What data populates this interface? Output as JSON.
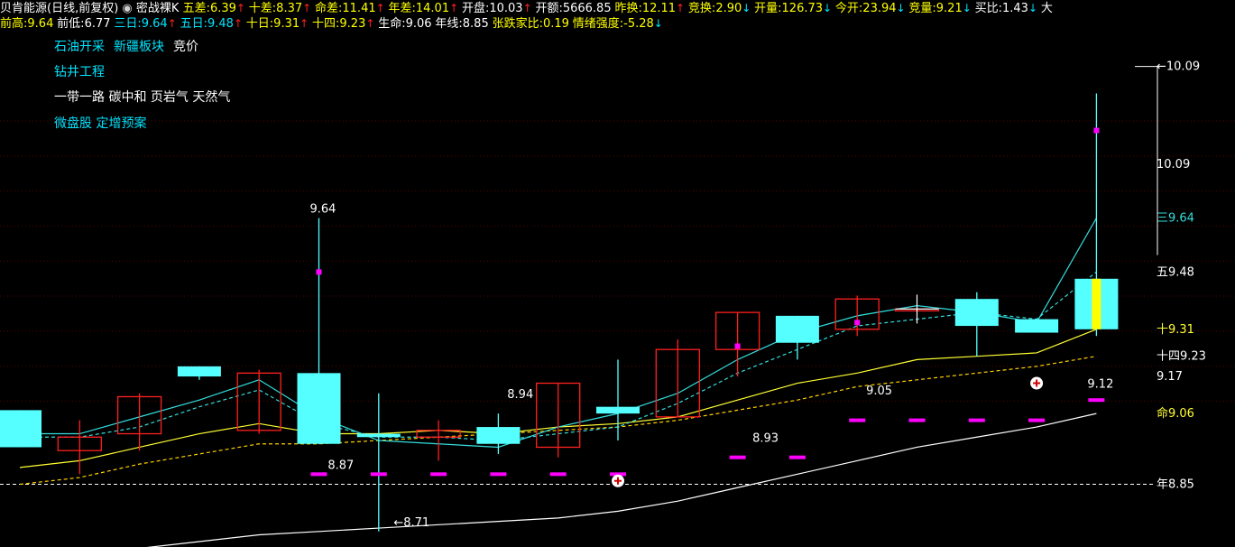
{
  "header": {
    "title": "贝肯能源(日线,前复权)",
    "gear_icon": "chevron-down-circle-icon",
    "indicator_name": "密战裸K",
    "row1": [
      {
        "label": "五差:",
        "value": "6.39",
        "arrow": "↑",
        "color": "#ffff00",
        "vcolor": "#ffff00",
        "acolor": "#ff2020"
      },
      {
        "label": "十差:",
        "value": "8.37",
        "arrow": "↑",
        "color": "#ffff00",
        "vcolor": "#ffff00",
        "acolor": "#ff2020"
      },
      {
        "label": "命差:",
        "value": "11.41",
        "arrow": "↑",
        "color": "#ffff00",
        "vcolor": "#ffff00",
        "acolor": "#ff2020"
      },
      {
        "label": "年差:",
        "value": "14.01",
        "arrow": "↑",
        "color": "#ffff00",
        "vcolor": "#ffff00",
        "acolor": "#ff2020"
      },
      {
        "label": "开盘:",
        "value": "10.03",
        "arrow": "↑",
        "color": "#ffffff",
        "vcolor": "#ffffff",
        "acolor": "#ff2020"
      },
      {
        "label": "开额:",
        "value": "5666.85",
        "arrow": "",
        "color": "#ffffff",
        "vcolor": "#ffffff",
        "acolor": "#ff2020"
      },
      {
        "label": "昨换:",
        "value": "12.11",
        "arrow": "↑",
        "color": "#ffff00",
        "vcolor": "#ffff00",
        "acolor": "#ff2020"
      },
      {
        "label": "竞换:",
        "value": "2.90",
        "arrow": "↓",
        "color": "#ffff00",
        "vcolor": "#ffff00",
        "acolor": "#00e5ff"
      },
      {
        "label": "开量:",
        "value": "126.73",
        "arrow": "↓",
        "color": "#ffff00",
        "vcolor": "#ffff00",
        "acolor": "#00e5ff"
      },
      {
        "label": "今开:",
        "value": "23.94",
        "arrow": "↓",
        "color": "#ffff00",
        "vcolor": "#ffff00",
        "acolor": "#00e5ff"
      },
      {
        "label": "竞量:",
        "value": "9.21",
        "arrow": "↓",
        "color": "#ffff00",
        "vcolor": "#ffff00",
        "acolor": "#00e5ff"
      },
      {
        "label": "买比:",
        "value": "1.43",
        "arrow": "↓",
        "color": "#ffffff",
        "vcolor": "#ffffff",
        "acolor": "#00e5ff"
      },
      {
        "label": "大",
        "value": "",
        "arrow": "",
        "color": "#ffffff",
        "vcolor": "#ffffff",
        "acolor": "#00e5ff"
      }
    ],
    "row2": [
      {
        "label": "前高:",
        "value": "9.64",
        "arrow": "",
        "color": "#ffff00",
        "vcolor": "#ffff00",
        "acolor": "#ff2020"
      },
      {
        "label": "前低:",
        "value": "6.77",
        "arrow": "",
        "color": "#ffffff",
        "vcolor": "#ffffff",
        "acolor": "#ff2020"
      },
      {
        "label": "三日:",
        "value": "9.64",
        "arrow": "↑",
        "color": "#00e5ff",
        "vcolor": "#00e5ff",
        "acolor": "#ff2020"
      },
      {
        "label": "五日:",
        "value": "9.48",
        "arrow": "↑",
        "color": "#00e5ff",
        "vcolor": "#00e5ff",
        "acolor": "#ff2020"
      },
      {
        "label": "十日:",
        "value": "9.31",
        "arrow": "↑",
        "color": "#ffff00",
        "vcolor": "#ffff00",
        "acolor": "#ff2020"
      },
      {
        "label": "十四:",
        "value": "9.23",
        "arrow": "↑",
        "color": "#ffff00",
        "vcolor": "#ffff00",
        "acolor": "#ff2020"
      },
      {
        "label": "生命:",
        "value": "9.06",
        "arrow": "",
        "color": "#ffffff",
        "vcolor": "#ffffff",
        "acolor": "#ff2020"
      },
      {
        "label": "年线:",
        "value": "8.85",
        "arrow": "",
        "color": "#ffffff",
        "vcolor": "#ffffff",
        "acolor": "#ff2020"
      },
      {
        "label": "张跌家比:",
        "value": "0.19",
        "arrow": "",
        "color": "#ffff00",
        "vcolor": "#ffff00",
        "acolor": "#ff2020"
      },
      {
        "label": "情绪强度:",
        "value": "-5.28",
        "arrow": "↓",
        "color": "#ffff00",
        "vcolor": "#ffff00",
        "acolor": "#00e5ff"
      }
    ]
  },
  "tags": {
    "line1": [
      {
        "text": "石油开采",
        "color": "#00e5ff"
      },
      {
        "text": "新疆板块",
        "color": "#00e5ff"
      },
      {
        "text": "竞价",
        "color": "#ffffff"
      }
    ],
    "line2": [
      {
        "text": "钻井工程",
        "color": "#00e5ff"
      }
    ],
    "line3": [
      {
        "text": "一带一路 碳中和 页岩气 天然气",
        "color": "#ffffff"
      }
    ],
    "line4": [
      {
        "text": "微盘股 定增预案",
        "color": "#00e5ff"
      }
    ]
  },
  "colors": {
    "up": "#ff2020",
    "down": "#55ffff",
    "ma3": "#33dddd",
    "ma5": "#33dddd",
    "ma10": "#ffff33",
    "ma14": "#ffd000",
    "life": "#ffffff",
    "year": "#ffffff",
    "marker": "#ff00ff"
  },
  "chart_data": {
    "type": "candlestick",
    "ylim": [
      8.68,
      10.18
    ],
    "candles": [
      {
        "o": 9.07,
        "h": 9.07,
        "l": 8.96,
        "c": 8.96,
        "up": false
      },
      {
        "o": 8.95,
        "h": 9.04,
        "l": 8.88,
        "c": 8.99,
        "up": true
      },
      {
        "o": 9.0,
        "h": 9.12,
        "l": 8.95,
        "c": 9.11,
        "up": true
      },
      {
        "o": 9.2,
        "h": 9.2,
        "l": 9.16,
        "c": 9.17,
        "up": false
      },
      {
        "o": 9.01,
        "h": 9.19,
        "l": 9.0,
        "c": 9.18,
        "up": true
      },
      {
        "o": 9.18,
        "h": 9.64,
        "l": 8.97,
        "c": 8.97,
        "up": false
      },
      {
        "o": 9.0,
        "h": 9.12,
        "l": 8.71,
        "c": 8.99,
        "up": false
      },
      {
        "o": 8.99,
        "h": 9.04,
        "l": 8.92,
        "c": 9.01,
        "up": true
      },
      {
        "o": 9.02,
        "h": 9.06,
        "l": 8.94,
        "c": 8.97,
        "up": false
      },
      {
        "o": 8.96,
        "h": 9.15,
        "l": 8.93,
        "c": 9.15,
        "up": true
      },
      {
        "o": 9.08,
        "h": 9.22,
        "l": 8.98,
        "c": 9.06,
        "up": false
      },
      {
        "o": 9.05,
        "h": 9.28,
        "l": 9.05,
        "c": 9.25,
        "up": true
      },
      {
        "o": 9.25,
        "h": 9.36,
        "l": 9.17,
        "c": 9.36,
        "up": true
      },
      {
        "o": 9.27,
        "h": 9.35,
        "l": 9.22,
        "c": 9.35,
        "up": false
      },
      {
        "o": 9.31,
        "h": 9.41,
        "l": 9.29,
        "c": 9.4,
        "up": true
      },
      {
        "o": 9.37,
        "h": 9.37,
        "l": 9.37,
        "c": 9.37,
        "up": true
      },
      {
        "o": 9.4,
        "h": 9.42,
        "l": 9.23,
        "c": 9.32,
        "up": false
      },
      {
        "o": 9.34,
        "h": 9.34,
        "l": 9.3,
        "c": 9.3,
        "up": false
      },
      {
        "o": 9.46,
        "h": 10.01,
        "l": 9.29,
        "c": 9.31,
        "up": false
      }
    ],
    "ma3": [
      9.0,
      9.0,
      9.05,
      9.1,
      9.16,
      9.05,
      8.98,
      8.97,
      8.96,
      9.02,
      9.06,
      9.12,
      9.22,
      9.3,
      9.35,
      9.38,
      9.36,
      9.33,
      9.64
    ],
    "ma5": [
      8.99,
      8.99,
      9.02,
      9.08,
      9.13,
      9.03,
      8.99,
      8.99,
      8.98,
      9.0,
      9.02,
      9.09,
      9.18,
      9.25,
      9.32,
      9.34,
      9.36,
      9.34,
      9.48
    ],
    "ma10": [
      8.9,
      8.92,
      8.96,
      9.0,
      9.03,
      9.0,
      9.0,
      9.01,
      9.0,
      9.02,
      9.03,
      9.05,
      9.1,
      9.15,
      9.18,
      9.22,
      9.23,
      9.24,
      9.31
    ],
    "ma14": [
      8.85,
      8.87,
      8.91,
      8.94,
      8.97,
      8.97,
      8.98,
      8.99,
      9.0,
      9.01,
      9.02,
      9.04,
      9.07,
      9.1,
      9.14,
      9.16,
      9.18,
      9.2,
      9.23
    ],
    "life": [
      8.62,
      8.64,
      8.66,
      8.68,
      8.7,
      8.71,
      8.72,
      8.73,
      8.74,
      8.75,
      8.77,
      8.8,
      8.84,
      8.88,
      8.92,
      8.96,
      8.99,
      9.02,
      9.06
    ],
    "year_line": 8.85,
    "markers_low": [
      null,
      null,
      null,
      null,
      null,
      8.88,
      8.88,
      8.88,
      8.88,
      8.88,
      8.88,
      null,
      8.93,
      8.93,
      9.04,
      9.04,
      9.04,
      9.04,
      9.1
    ],
    "markers_high": [
      null,
      null,
      null,
      null,
      null,
      9.48,
      null,
      null,
      null,
      null,
      null,
      null,
      9.26,
      null,
      9.33,
      null,
      null,
      null,
      9.9
    ],
    "labels": [
      {
        "x": 5,
        "y": 9.64,
        "text": "9.64"
      },
      {
        "x": 5.3,
        "y": 8.88,
        "text": "8.87"
      },
      {
        "x": 6.4,
        "y": 8.71,
        "text": "←8.71"
      },
      {
        "x": 8.3,
        "y": 9.09,
        "text": "8.94"
      },
      {
        "x": 12.4,
        "y": 8.96,
        "text": "8.93"
      },
      {
        "x": 14.3,
        "y": 9.1,
        "text": "9.05"
      },
      {
        "x": 18.0,
        "y": 9.12,
        "text": "9.12"
      }
    ],
    "right_labels": [
      {
        "y": 10.09,
        "text": "10.09",
        "color": "#ffffff",
        "prefix": "←"
      },
      {
        "y": 9.8,
        "text": "10.09",
        "color": "#ffffff",
        "prefix": ""
      },
      {
        "y": 9.64,
        "text": "9.64",
        "color": "#33dddd",
        "prefix": "三"
      },
      {
        "y": 9.48,
        "text": "9.48",
        "color": "#ffffff",
        "prefix": "五"
      },
      {
        "y": 9.31,
        "text": "9.31",
        "color": "#ffff33",
        "prefix": "十"
      },
      {
        "y": 9.23,
        "text": "9.23",
        "color": "#ffffff",
        "prefix": "十四"
      },
      {
        "y": 9.17,
        "text": "9.17",
        "color": "#ffffff",
        "prefix": ""
      },
      {
        "y": 9.06,
        "text": "9.06",
        "color": "#ffff33",
        "prefix": "命"
      },
      {
        "y": 8.85,
        "text": "8.85",
        "color": "#ffffff",
        "prefix": "年"
      }
    ]
  }
}
